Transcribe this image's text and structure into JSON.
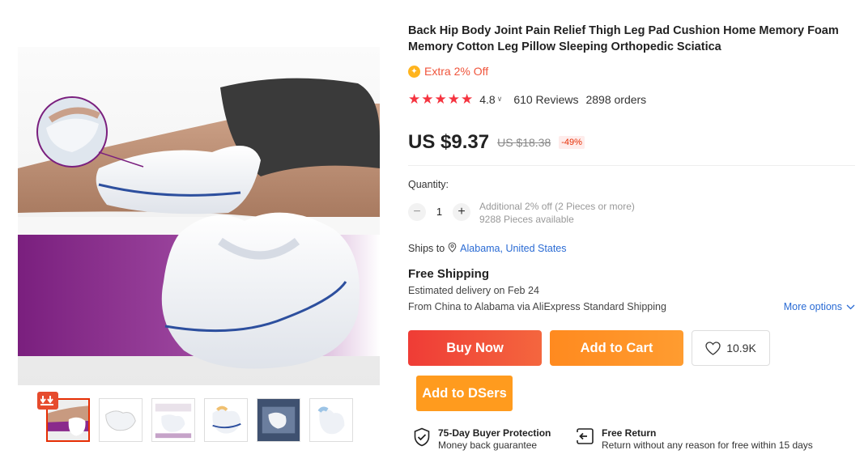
{
  "product": {
    "title": "Back Hip Body Joint Pain Relief Thigh Leg Pad Cushion Home Memory Foam Memory Cotton Leg Pillow Sleeping Orthopedic Sciatica",
    "coupon_text": "Extra 2% Off",
    "rating": {
      "stars": 5,
      "value": "4.8",
      "reviews": "610 Reviews",
      "orders": "2898 orders"
    },
    "price": {
      "current": "US $9.37",
      "original": "US $18.38",
      "discount": "-49%"
    }
  },
  "quantity": {
    "label": "Quantity:",
    "minus": "−",
    "value": "1",
    "plus": "+",
    "promo": "Additional 2% off (2 Pieces or more)",
    "available": "9288 Pieces available"
  },
  "shipping": {
    "ships_to_label": "Ships to",
    "destination": "Alabama, United States",
    "method_title": "Free Shipping",
    "estimated": "Estimated delivery on Feb 24",
    "route": "From China to Alabama via AliExpress Standard Shipping",
    "more_options": "More options"
  },
  "actions": {
    "buy_now": "Buy Now",
    "add_to_cart": "Add to Cart",
    "wishlist_count": "10.9K",
    "add_to_dsers": "Add to DSers"
  },
  "guarantees": [
    {
      "title": "75-Day Buyer Protection",
      "subtitle": "Money back guarantee",
      "icon": "shield-check-icon"
    },
    {
      "title": "Free Return",
      "subtitle": "Return without any reason for free within 15 days",
      "icon": "return-icon"
    }
  ],
  "gallery": {
    "thumbnail_count": 6,
    "active_index": 0
  },
  "colors": {
    "accent_red": "#f5333f",
    "buy_now": "#ef3c36",
    "add_to_cart": "#ff8a1f",
    "dsers": "#ff9b1e",
    "link_blue": "#2a6bd4",
    "pillow_blue": "#2d4f9e",
    "purple_band": "#8a2a8c"
  }
}
